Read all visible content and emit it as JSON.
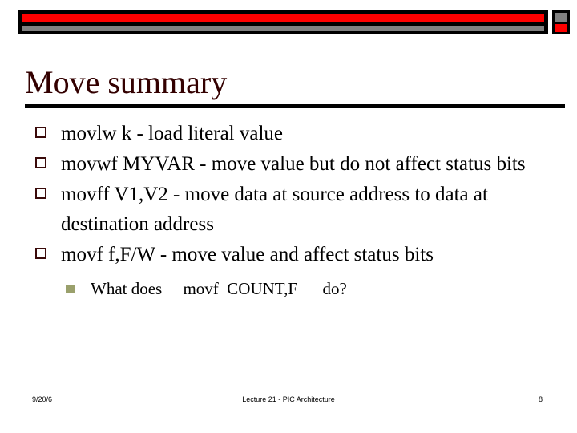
{
  "slide": {
    "title": "Move summary",
    "title_color": "#330000",
    "rule_color": "#000000",
    "background_color": "#ffffff"
  },
  "banner": {
    "red_color": "#ff0000",
    "gray_color": "#808080",
    "frame_color": "#000000"
  },
  "bullets": [
    {
      "marker": "hollow-square",
      "text": "movlw  k  - load literal value"
    },
    {
      "marker": "hollow-square",
      "text": "movwf  MYVAR  - move value but do not affect status bits"
    },
    {
      "marker": "hollow-square",
      "text": "movff  V1,V2  - move data at source address to data at destination address"
    },
    {
      "marker": "hollow-square",
      "text": "movf  f,F/W  - move value and affect status bits"
    }
  ],
  "sub_bullets": [
    {
      "marker": "filled-square",
      "marker_color": "#9aa06c",
      "text": "What does     movf  COUNT,F      do?"
    }
  ],
  "footer": {
    "date": "9/20/6",
    "center": "Lecture 21 - PIC Architecture",
    "page_number": "8"
  }
}
